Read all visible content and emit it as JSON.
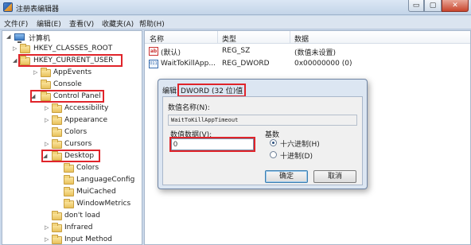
{
  "window": {
    "title": "注册表编辑器",
    "controls": {
      "minimize": "▭",
      "maximize": "▢",
      "close": "✕"
    }
  },
  "menu": [
    "文件(F)",
    "编辑(E)",
    "查看(V)",
    "收藏夹(A)",
    "帮助(H)"
  ],
  "tree": [
    {
      "label": "计算机",
      "expander": "◢",
      "kind": "computer"
    },
    {
      "label": "HKEY_CLASSES_ROOT",
      "expander": "▷",
      "kind": "folder"
    },
    {
      "label": "HKEY_CURRENT_USER",
      "expander": "◢",
      "kind": "folder"
    },
    {
      "label": "AppEvents",
      "expander": "▷",
      "kind": "folder"
    },
    {
      "label": "Console",
      "expander": "",
      "kind": "folder"
    },
    {
      "label": "Control Panel",
      "expander": "◢",
      "kind": "folder"
    },
    {
      "label": "Accessibility",
      "expander": "▷",
      "kind": "folder"
    },
    {
      "label": "Appearance",
      "expander": "▷",
      "kind": "folder"
    },
    {
      "label": "Colors",
      "expander": "",
      "kind": "folder"
    },
    {
      "label": "Cursors",
      "expander": "▷",
      "kind": "folder"
    },
    {
      "label": "Desktop",
      "expander": "◢",
      "kind": "folder"
    },
    {
      "label": "Colors",
      "expander": "",
      "kind": "folder"
    },
    {
      "label": "LanguageConfig",
      "expander": "",
      "kind": "folder"
    },
    {
      "label": "MuiCached",
      "expander": "",
      "kind": "folder"
    },
    {
      "label": "WindowMetrics",
      "expander": "",
      "kind": "folder"
    },
    {
      "label": "don't load",
      "expander": "",
      "kind": "folder"
    },
    {
      "label": "Infrared",
      "expander": "▷",
      "kind": "folder"
    },
    {
      "label": "Input Method",
      "expander": "▷",
      "kind": "folder"
    }
  ],
  "list": {
    "headers": [
      "名称",
      "类型",
      "数据"
    ],
    "rows": [
      {
        "icon": "ab",
        "name": "(默认)",
        "type": "REG_SZ",
        "data": "(数值未设置)"
      },
      {
        "icon": "011",
        "name": "WaitToKillApp...",
        "type": "REG_DWORD",
        "data": "0x00000000 (0)"
      }
    ]
  },
  "dialog": {
    "title_prefix": "编辑",
    "title_boxed": "DWORD (32 位)值",
    "name_label": "数值名称(N):",
    "name_value": "WaitToKillAppTimeout",
    "data_label": "数值数据(V):",
    "data_value": "0",
    "base_label": "基数",
    "hex_label": "十六进制(H)",
    "dec_label": "十进制(D)",
    "selected_base": "hex",
    "ok_label": "确定",
    "cancel_label": "取消"
  }
}
